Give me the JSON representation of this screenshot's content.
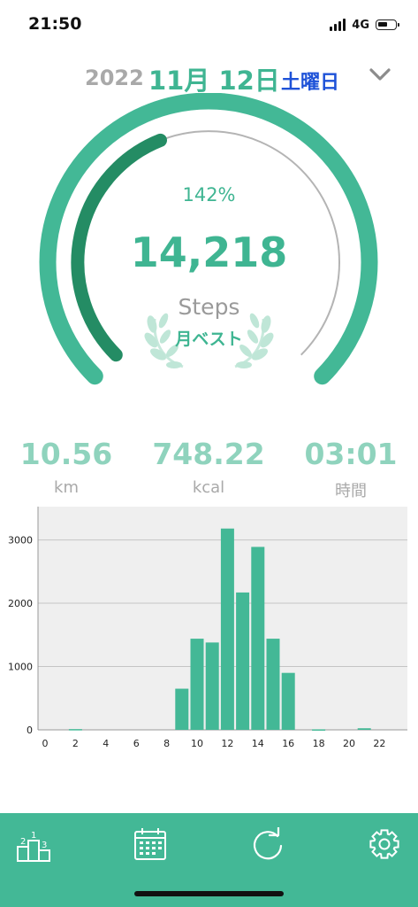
{
  "status_bar": {
    "time": "21:50",
    "network": "4G",
    "battery_level": 0.6,
    "signal_bars": 4
  },
  "date": {
    "year": "2022",
    "month_day": "11月 12日",
    "weekday": "土曜日",
    "dropdown_icon": "chevron-down-icon"
  },
  "gauge": {
    "percent_text": "142%",
    "percent": 142,
    "steps": "14,218",
    "unit": "Steps",
    "badge": "月ベスト",
    "badge_icon": "laurel-icon"
  },
  "stats": [
    {
      "value": "10.56",
      "unit": "km"
    },
    {
      "value": "748.22",
      "unit": "kcal"
    },
    {
      "value": "03:01",
      "unit": "時間"
    }
  ],
  "chart_data": {
    "type": "bar",
    "x": [
      0,
      1,
      2,
      3,
      4,
      5,
      6,
      7,
      8,
      9,
      10,
      11,
      12,
      13,
      14,
      15,
      16,
      17,
      18,
      19,
      20,
      21,
      22,
      23
    ],
    "values": [
      0,
      0,
      12,
      0,
      0,
      0,
      0,
      0,
      0,
      650,
      1440,
      1380,
      3180,
      2170,
      2890,
      1440,
      900,
      0,
      8,
      0,
      0,
      25,
      0,
      0
    ],
    "x_tick_labels": [
      "0",
      "2",
      "4",
      "6",
      "8",
      "10",
      "12",
      "14",
      "16",
      "18",
      "20",
      "22"
    ],
    "y_tick_labels": [
      "0",
      "1000",
      "2000",
      "3000"
    ],
    "ylim": [
      0,
      3400
    ],
    "xlim": [
      0,
      24
    ],
    "grid": true,
    "title": "",
    "xlabel": "",
    "ylabel": ""
  },
  "colors": {
    "accent": "#43b896",
    "accent_dark": "#248c64",
    "chart_bar": "#43b896",
    "chart_bg": "#efefef",
    "weekday": "#1e52d8"
  },
  "tabbar": [
    {
      "name": "ranking-podium-icon"
    },
    {
      "name": "calendar-icon"
    },
    {
      "name": "refresh-icon"
    },
    {
      "name": "settings-gear-icon"
    }
  ]
}
